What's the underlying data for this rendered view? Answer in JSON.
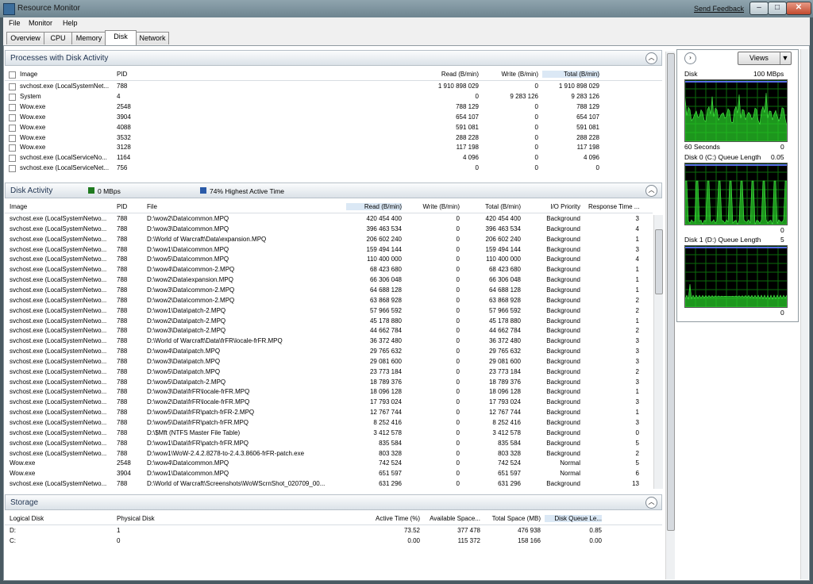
{
  "window": {
    "title": "Resource Monitor",
    "send_feedback": "Send Feedback",
    "min": "–",
    "max": "□",
    "close": "✕"
  },
  "menu": [
    "File",
    "Monitor",
    "Help"
  ],
  "tabs": [
    "Overview",
    "CPU",
    "Memory",
    "Disk",
    "Network"
  ],
  "active_tab": "Disk",
  "processes": {
    "title": "Processes with Disk Activity",
    "columns": [
      "Image",
      "PID",
      "Read (B/min)",
      "Write (B/min)",
      "Total (B/min)"
    ],
    "rows": [
      [
        "svchost.exe (LocalSystemNet...",
        "788",
        "1 910 898 029",
        "0",
        "1 910 898 029"
      ],
      [
        "System",
        "4",
        "0",
        "9 283 126",
        "9 283 126"
      ],
      [
        "Wow.exe",
        "2548",
        "788 129",
        "0",
        "788 129"
      ],
      [
        "Wow.exe",
        "3904",
        "654 107",
        "0",
        "654 107"
      ],
      [
        "Wow.exe",
        "4088",
        "591 081",
        "0",
        "591 081"
      ],
      [
        "Wow.exe",
        "3532",
        "288 228",
        "0",
        "288 228"
      ],
      [
        "Wow.exe",
        "3128",
        "117 198",
        "0",
        "117 198"
      ],
      [
        "svchost.exe (LocalServiceNo...",
        "1164",
        "4 096",
        "0",
        "4 096"
      ],
      [
        "svchost.exe (LocalServiceNet...",
        "756",
        "0",
        "0",
        "0"
      ]
    ]
  },
  "disk_activity": {
    "title": "Disk Activity",
    "io_value": "0 MBps",
    "active_time": "74% Highest Active Time",
    "io_color": "#1f7a1f",
    "active_color": "#2a5aa8",
    "columns": [
      "Image",
      "PID",
      "File",
      "Read (B/min)",
      "Write (B/min)",
      "Total (B/min)",
      "I/O Priority",
      "Response Time ..."
    ],
    "rows": [
      [
        "svchost.exe (LocalSystemNetwo...",
        "788",
        "D:\\wow2\\Data\\common.MPQ",
        "420 454 400",
        "0",
        "420 454 400",
        "Background",
        "3"
      ],
      [
        "svchost.exe (LocalSystemNetwo...",
        "788",
        "D:\\wow3\\Data\\common.MPQ",
        "396 463 534",
        "0",
        "396 463 534",
        "Background",
        "4"
      ],
      [
        "svchost.exe (LocalSystemNetwo...",
        "788",
        "D:\\World of Warcraft\\Data\\expansion.MPQ",
        "206 602 240",
        "0",
        "206 602 240",
        "Background",
        "1"
      ],
      [
        "svchost.exe (LocalSystemNetwo...",
        "788",
        "D:\\wow1\\Data\\common.MPQ",
        "159 494 144",
        "0",
        "159 494 144",
        "Background",
        "3"
      ],
      [
        "svchost.exe (LocalSystemNetwo...",
        "788",
        "D:\\wow5\\Data\\common.MPQ",
        "110 400 000",
        "0",
        "110 400 000",
        "Background",
        "4"
      ],
      [
        "svchost.exe (LocalSystemNetwo...",
        "788",
        "D:\\wow4\\Data\\common-2.MPQ",
        "68 423 680",
        "0",
        "68 423 680",
        "Background",
        "1"
      ],
      [
        "svchost.exe (LocalSystemNetwo...",
        "788",
        "D:\\wow2\\Data\\expansion.MPQ",
        "66 306 048",
        "0",
        "66 306 048",
        "Background",
        "1"
      ],
      [
        "svchost.exe (LocalSystemNetwo...",
        "788",
        "D:\\wow3\\Data\\common-2.MPQ",
        "64 688 128",
        "0",
        "64 688 128",
        "Background",
        "1"
      ],
      [
        "svchost.exe (LocalSystemNetwo...",
        "788",
        "D:\\wow2\\Data\\common-2.MPQ",
        "63 868 928",
        "0",
        "63 868 928",
        "Background",
        "2"
      ],
      [
        "svchost.exe (LocalSystemNetwo...",
        "788",
        "D:\\wow1\\Data\\patch-2.MPQ",
        "57 966 592",
        "0",
        "57 966 592",
        "Background",
        "2"
      ],
      [
        "svchost.exe (LocalSystemNetwo...",
        "788",
        "D:\\wow2\\Data\\patch-2.MPQ",
        "45 178 880",
        "0",
        "45 178 880",
        "Background",
        "1"
      ],
      [
        "svchost.exe (LocalSystemNetwo...",
        "788",
        "D:\\wow3\\Data\\patch-2.MPQ",
        "44 662 784",
        "0",
        "44 662 784",
        "Background",
        "2"
      ],
      [
        "svchost.exe (LocalSystemNetwo...",
        "788",
        "D:\\World of Warcraft\\Data\\frFR\\locale-frFR.MPQ",
        "36 372 480",
        "0",
        "36 372 480",
        "Background",
        "3"
      ],
      [
        "svchost.exe (LocalSystemNetwo...",
        "788",
        "D:\\wow4\\Data\\patch.MPQ",
        "29 765 632",
        "0",
        "29 765 632",
        "Background",
        "3"
      ],
      [
        "svchost.exe (LocalSystemNetwo...",
        "788",
        "D:\\wow3\\Data\\patch.MPQ",
        "29 081 600",
        "0",
        "29 081 600",
        "Background",
        "3"
      ],
      [
        "svchost.exe (LocalSystemNetwo...",
        "788",
        "D:\\wow5\\Data\\patch.MPQ",
        "23 773 184",
        "0",
        "23 773 184",
        "Background",
        "2"
      ],
      [
        "svchost.exe (LocalSystemNetwo...",
        "788",
        "D:\\wow5\\Data\\patch-2.MPQ",
        "18 789 376",
        "0",
        "18 789 376",
        "Background",
        "3"
      ],
      [
        "svchost.exe (LocalSystemNetwo...",
        "788",
        "D:\\wow3\\Data\\frFR\\locale-frFR.MPQ",
        "18 096 128",
        "0",
        "18 096 128",
        "Background",
        "1"
      ],
      [
        "svchost.exe (LocalSystemNetwo...",
        "788",
        "D:\\wow2\\Data\\frFR\\locale-frFR.MPQ",
        "17 793 024",
        "0",
        "17 793 024",
        "Background",
        "3"
      ],
      [
        "svchost.exe (LocalSystemNetwo...",
        "788",
        "D:\\wow5\\Data\\frFR\\patch-frFR-2.MPQ",
        "12 767 744",
        "0",
        "12 767 744",
        "Background",
        "1"
      ],
      [
        "svchost.exe (LocalSystemNetwo...",
        "788",
        "D:\\wow5\\Data\\frFR\\patch-frFR.MPQ",
        "8 252 416",
        "0",
        "8 252 416",
        "Background",
        "3"
      ],
      [
        "svchost.exe (LocalSystemNetwo...",
        "788",
        "D:\\$Mft (NTFS Master File Table)",
        "3 412 578",
        "0",
        "3 412 578",
        "Background",
        "0"
      ],
      [
        "svchost.exe (LocalSystemNetwo...",
        "788",
        "D:\\wow1\\Data\\frFR\\patch-frFR.MPQ",
        "835 584",
        "0",
        "835 584",
        "Background",
        "5"
      ],
      [
        "svchost.exe (LocalSystemNetwo...",
        "788",
        "D:\\wow1\\WoW-2.4.2.8278-to-2.4.3.8606-frFR-patch.exe",
        "803 328",
        "0",
        "803 328",
        "Background",
        "2"
      ],
      [
        "Wow.exe",
        "2548",
        "D:\\wow4\\Data\\common.MPQ",
        "742 524",
        "0",
        "742 524",
        "Normal",
        "5"
      ],
      [
        "Wow.exe",
        "3904",
        "D:\\wow1\\Data\\common.MPQ",
        "651 597",
        "0",
        "651 597",
        "Normal",
        "6"
      ],
      [
        "svchost.exe (LocalSystemNetwo...",
        "788",
        "D:\\World of Warcraft\\Screenshots\\WoWScrnShot_020709_00...",
        "631 296",
        "0",
        "631 296",
        "Background",
        "13"
      ]
    ]
  },
  "storage": {
    "title": "Storage",
    "columns": [
      "Logical Disk",
      "Physical Disk",
      "Active Time (%)",
      "Available Space...",
      "Total Space (MB)",
      "Disk Queue Le..."
    ],
    "rows": [
      [
        "D:",
        "1",
        "73.52",
        "377 478",
        "476 938",
        "0.85"
      ],
      [
        "C:",
        "0",
        "0.00",
        "115 372",
        "158 166",
        "0.00"
      ]
    ]
  },
  "graphs": {
    "views_label": "Views",
    "disk": {
      "label": "Disk",
      "max": "100 MBps",
      "time": "60 Seconds",
      "min": "0"
    },
    "disk0": {
      "label": "Disk 0 (C:) Queue Length",
      "max": "0.05",
      "min": "0"
    },
    "disk1": {
      "label": "Disk 1 (D:) Queue Length",
      "max": "5",
      "min": "0"
    }
  },
  "colors": {
    "graph_bg": "#000000",
    "graph_grid": "#0b6b0b",
    "graph_fill": "#27c827",
    "graph_line": "#5a6fe8"
  }
}
